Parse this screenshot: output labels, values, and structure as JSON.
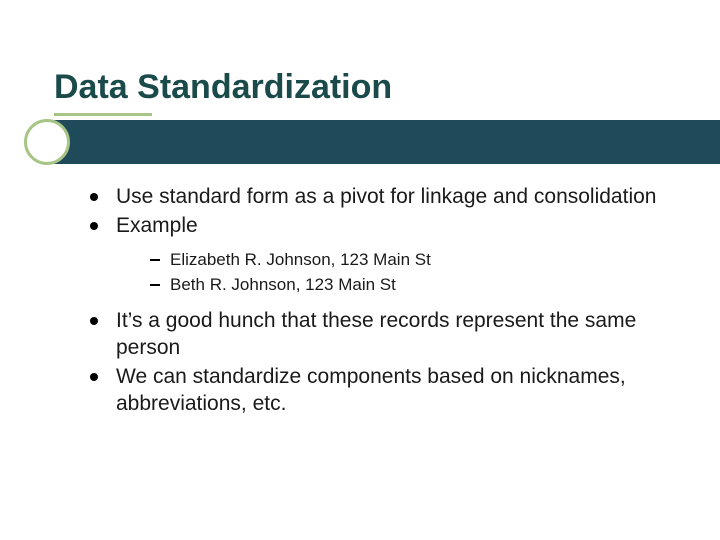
{
  "title": "Data Standardization",
  "bullets": {
    "b1": "Use standard form as a pivot for linkage and consolidation",
    "b2": "Example",
    "b2_sub1": "Elizabeth R. Johnson, 123 Main St",
    "b2_sub2": "Beth R. Johnson, 123 Main St",
    "b3": "It’s a good hunch that these records represent the same person",
    "b4": "We can standardize components based on nicknames, abbreviations, etc."
  }
}
